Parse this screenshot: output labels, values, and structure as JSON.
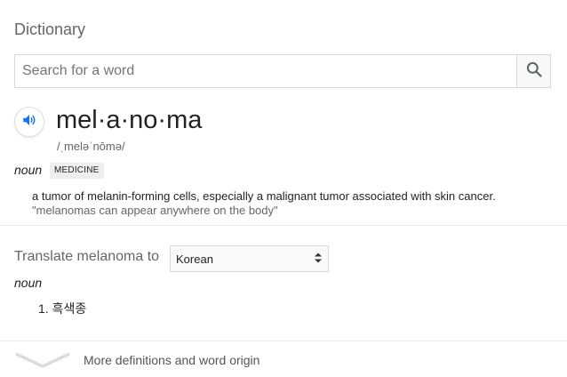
{
  "card": {
    "title": "Dictionary"
  },
  "search": {
    "placeholder": "Search for a word",
    "value": "",
    "button_icon": "search-icon"
  },
  "entry": {
    "speaker_icon": "speaker-icon",
    "headword": "mel·a·no·ma",
    "phonetic": "/ˌmeləˈnōmə/",
    "part_of_speech": "noun",
    "domain_label": "MEDICINE",
    "definition": "a tumor of melanin-forming cells, especially a malignant tumor associated with skin cancer.",
    "example": "\"melanomas can appear anywhere on the body\""
  },
  "translate": {
    "label": "Translate melanoma to",
    "selected_language": "Korean",
    "part_of_speech": "noun",
    "items": [
      {
        "number": "1.",
        "text": "흑색종"
      }
    ]
  },
  "footer": {
    "more_label": "More definitions and word origin",
    "chevron_icon": "chevron-down-icon"
  },
  "colors": {
    "accent_blue": "#1a73e8",
    "muted_text": "#666666",
    "border": "#d9d9d9"
  }
}
